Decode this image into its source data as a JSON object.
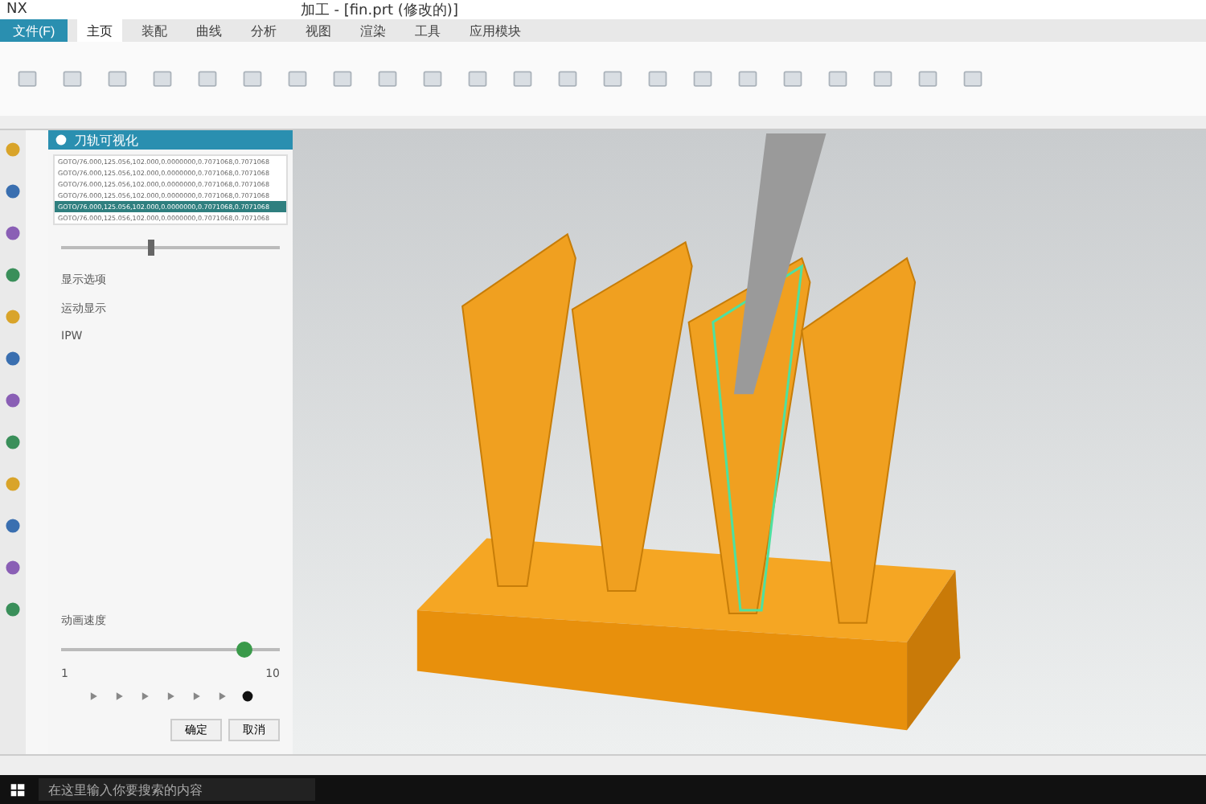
{
  "title_bar": {
    "app_name": "NX",
    "title": "加工 - [fin.prt (修改的)]"
  },
  "menu": {
    "file_button": "文件(F)",
    "tabs": [
      {
        "label": "主页",
        "selected": true
      },
      {
        "label": "装配",
        "selected": false
      },
      {
        "label": "曲线",
        "selected": false
      },
      {
        "label": "分析",
        "selected": false
      },
      {
        "label": "视图",
        "selected": false
      },
      {
        "label": "渲染",
        "selected": false
      },
      {
        "label": "工具",
        "selected": false
      },
      {
        "label": "应用模块",
        "selected": false
      }
    ]
  },
  "panel": {
    "title": "刀轨可视化",
    "toolpath_lines": [
      {
        "text": "GOTO/76.000,125.056,102.000,0.0000000,0.7071068,0.7071068",
        "selected": false
      },
      {
        "text": "GOTO/76.000,125.056,102.000,0.0000000,0.7071068,0.7071068",
        "selected": false
      },
      {
        "text": "GOTO/76.000,125.056,102.000,0.0000000,0.7071068,0.7071068",
        "selected": false
      },
      {
        "text": "GOTO/76.000,125.056,102.000,0.0000000,0.7071068,0.7071068",
        "selected": false
      },
      {
        "text": "GOTO/76.000,125.056,102.000,0.0000000,0.7071068,0.7071068",
        "selected": true
      },
      {
        "text": "GOTO/76.000,125.056,102.000,0.0000000,0.7071068,0.7071068",
        "selected": false
      }
    ],
    "position_slider": {
      "level": 0.4
    },
    "sections": [
      "显示选项",
      "运动显示",
      "IPW"
    ],
    "speed_label": "动画速度",
    "speed_slider": {
      "level": 0.8,
      "min": "1",
      "max": "10"
    },
    "buttons": [
      "确定",
      "取消"
    ]
  },
  "taskbar": {
    "search_placeholder": "在这里输入你要搜索的内容"
  }
}
